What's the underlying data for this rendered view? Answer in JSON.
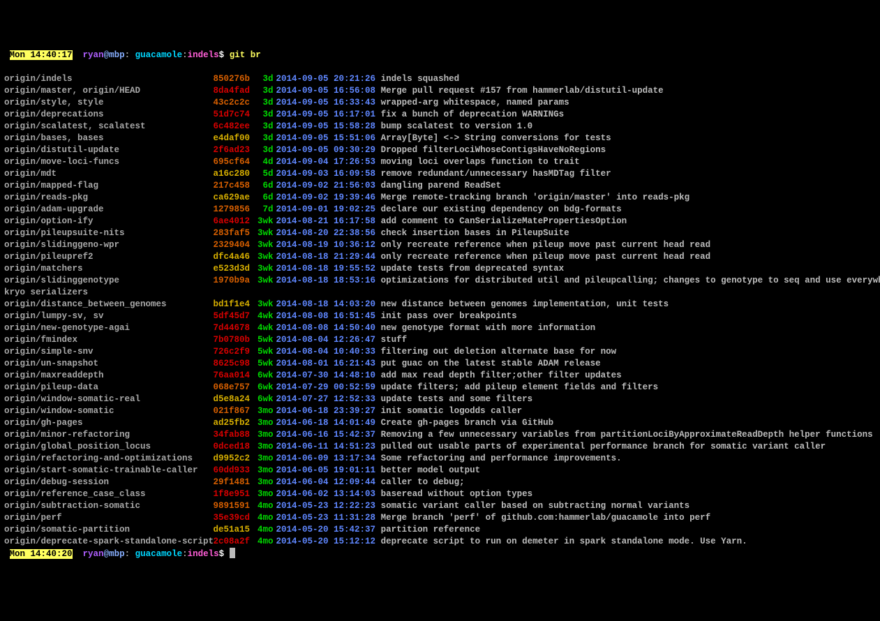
{
  "promptTop": {
    "time": "Mon 14:40:17",
    "user": "ryan",
    "host": "mbp",
    "path": "guacamole",
    "branch": "indels",
    "cmd": "git br"
  },
  "promptBottom": {
    "time": "Mon 14:40:20",
    "user": "ryan",
    "host": "mbp",
    "path": "guacamole",
    "branch": "indels",
    "cmd": ""
  },
  "rows": [
    {
      "branch": "origin/indels",
      "hash": "850276b",
      "hc": "hashOrange",
      "age": "3d",
      "date": "2014-09-05 20:21:26",
      "msg": "indels squashed"
    },
    {
      "branch": "origin/master, origin/HEAD",
      "hash": "8da4fad",
      "hc": "hashRed",
      "age": "3d",
      "date": "2014-09-05 16:56:08",
      "msg": "Merge pull request #157 from hammerlab/distutil-update"
    },
    {
      "branch": "origin/style, style",
      "hash": "43c2c2c",
      "hc": "hashOrange",
      "age": "3d",
      "date": "2014-09-05 16:33:43",
      "msg": "wrapped-arg whitespace, named params"
    },
    {
      "branch": "origin/deprecations",
      "hash": "51d7c74",
      "hc": "hashRed",
      "age": "3d",
      "date": "2014-09-05 16:17:01",
      "msg": "fix a bunch of deprecation WARNINGs"
    },
    {
      "branch": "origin/scalatest, scalatest",
      "hash": "6c482ee",
      "hc": "hashRed",
      "age": "3d",
      "date": "2014-09-05 15:58:28",
      "msg": "bump scalatest to version 1.0"
    },
    {
      "branch": "origin/bases, bases",
      "hash": "e4daf00",
      "hc": "hashYell",
      "age": "3d",
      "date": "2014-09-05 15:51:06",
      "msg": "Array[Byte] <-> String conversions for tests"
    },
    {
      "branch": "origin/distutil-update",
      "hash": "2f6ad23",
      "hc": "hashRed",
      "age": "3d",
      "date": "2014-09-05 09:30:29",
      "msg": "Dropped filterLociWhoseContigsHaveNoRegions"
    },
    {
      "branch": "origin/move-loci-funcs",
      "hash": "695cf64",
      "hc": "hashOrange",
      "age": "4d",
      "date": "2014-09-04 17:26:53",
      "msg": "moving loci overlaps function to trait"
    },
    {
      "branch": "origin/mdt",
      "hash": "a16c280",
      "hc": "hashYell",
      "age": "5d",
      "date": "2014-09-03 16:09:58",
      "msg": "remove redundant/unnecessary hasMDTag filter"
    },
    {
      "branch": "origin/mapped-flag",
      "hash": "217c458",
      "hc": "hashOrange",
      "age": "6d",
      "date": "2014-09-02 21:56:03",
      "msg": "dangling parend ReadSet"
    },
    {
      "branch": "origin/reads-pkg",
      "hash": "ca629ae",
      "hc": "hashYell",
      "age": "6d",
      "date": "2014-09-02 19:39:46",
      "msg": "Merge remote-tracking branch 'origin/master' into reads-pkg"
    },
    {
      "branch": "origin/adam-upgrade",
      "hash": "1279856",
      "hc": "hashOrange",
      "age": "7d",
      "date": "2014-09-01 19:02:25",
      "msg": "declare our existing dependency on bdg-formats"
    },
    {
      "branch": "origin/option-ify",
      "hash": "6ae4012",
      "hc": "hashRed",
      "age": "3wk",
      "date": "2014-08-21 16:17:58",
      "msg": "add comment to CanSerializeMatePropertiesOption"
    },
    {
      "branch": "origin/pileupsuite-nits",
      "hash": "283faf5",
      "hc": "hashOrange",
      "age": "3wk",
      "date": "2014-08-20 22:38:56",
      "msg": "check insertion bases in PileupSuite"
    },
    {
      "branch": "origin/slidinggeno-wpr",
      "hash": "2329404",
      "hc": "hashOrange",
      "age": "3wk",
      "date": "2014-08-19 10:36:12",
      "msg": "only recreate reference when pileup move past current head read"
    },
    {
      "branch": "origin/pileupref2",
      "hash": "dfc4a46",
      "hc": "hashYell",
      "age": "3wk",
      "date": "2014-08-18 21:29:44",
      "msg": "only recreate reference when pileup move past current head read"
    },
    {
      "branch": "origin/matchers",
      "hash": "e523d3d",
      "hc": "hashYell",
      "age": "3wk",
      "date": "2014-08-18 19:55:52",
      "msg": "update tests from deprecated syntax"
    },
    {
      "branch": "origin/slidinggenotype",
      "hash": "1970b9a",
      "hc": "hashOrange",
      "age": "3wk",
      "date": "2014-08-18 18:53:16",
      "msg": "optimizations for distributed util and pileupcalling; changes to genotype to seq and use everywhere; add",
      "wrap": "kryo serializers"
    },
    {
      "branch": "origin/distance_between_genomes",
      "hash": "bd1f1e4",
      "hc": "hashYell",
      "age": "3wk",
      "date": "2014-08-18 14:03:20",
      "msg": "new distance between genomes implementation, unit tests"
    },
    {
      "branch": "origin/lumpy-sv, sv",
      "hash": "5df45d7",
      "hc": "hashRed",
      "age": "4wk",
      "date": "2014-08-08 16:51:45",
      "msg": "init pass over breakpoints"
    },
    {
      "branch": "origin/new-genotype-agai",
      "hash": "7d44678",
      "hc": "hashRed",
      "age": "4wk",
      "date": "2014-08-08 14:50:40",
      "msg": "new genotype format with more information"
    },
    {
      "branch": "origin/fmindex",
      "hash": "7b0780b",
      "hc": "hashRed",
      "age": "5wk",
      "date": "2014-08-04 12:26:47",
      "msg": "stuff"
    },
    {
      "branch": "origin/simple-snv",
      "hash": "726c2f9",
      "hc": "hashRed",
      "age": "5wk",
      "date": "2014-08-04 10:40:33",
      "msg": "filtering out deletion alternate base for now"
    },
    {
      "branch": "origin/un-snapshot",
      "hash": "8625c98",
      "hc": "hashRed",
      "age": "5wk",
      "date": "2014-08-01 16:21:43",
      "msg": "put guac on the latest stable ADAM release"
    },
    {
      "branch": "origin/maxreaddepth",
      "hash": "76aa014",
      "hc": "hashRed",
      "age": "6wk",
      "date": "2014-07-30 14:48:10",
      "msg": "add max read depth filter;other filter updates"
    },
    {
      "branch": "origin/pileup-data",
      "hash": "068e757",
      "hc": "hashOrange",
      "age": "6wk",
      "date": "2014-07-29 00:52:59",
      "msg": "update filters; add pileup element fields and filters"
    },
    {
      "branch": "origin/window-somatic-real",
      "hash": "d5e8a24",
      "hc": "hashYell",
      "age": "6wk",
      "date": "2014-07-27 12:52:33",
      "msg": "update tests and some filters"
    },
    {
      "branch": "origin/window-somatic",
      "hash": "021f867",
      "hc": "hashOrange",
      "age": "3mo",
      "date": "2014-06-18 23:39:27",
      "msg": "init somatic logodds caller"
    },
    {
      "branch": "origin/gh-pages",
      "hash": "ad25fb2",
      "hc": "hashYell",
      "age": "3mo",
      "date": "2014-06-18 14:01:49",
      "msg": "Create gh-pages branch via GitHub"
    },
    {
      "branch": "origin/minor-refactoring",
      "hash": "34fab88",
      "hc": "hashRed",
      "age": "3mo",
      "date": "2014-06-16 15:42:37",
      "msg": "Removing a few unnecessary variables from partitionLociByApproximateReadDepth helper functions"
    },
    {
      "branch": "origin/global_position_locus",
      "hash": "0dced18",
      "hc": "hashRed",
      "age": "3mo",
      "date": "2014-06-11 14:51:23",
      "msg": "pulled out usable parts of experimental performance branch for somatic variant caller"
    },
    {
      "branch": "origin/refactoring-and-optimizations",
      "hash": "d9952c2",
      "hc": "hashYell",
      "age": "3mo",
      "date": "2014-06-09 13:17:34",
      "msg": "Some refactoring and performance improvements."
    },
    {
      "branch": "origin/start-somatic-trainable-caller",
      "hash": "60dd933",
      "hc": "hashRed",
      "age": "3mo",
      "date": "2014-06-05 19:01:11",
      "msg": "better model output"
    },
    {
      "branch": "origin/debug-session",
      "hash": "29f1481",
      "hc": "hashOrange",
      "age": "3mo",
      "date": "2014-06-04 12:09:44",
      "msg": "caller to debug;"
    },
    {
      "branch": "origin/reference_case_class",
      "hash": "1f8e951",
      "hc": "hashRed",
      "age": "3mo",
      "date": "2014-06-02 13:14:03",
      "msg": "baseread without option types"
    },
    {
      "branch": "origin/subtraction-somatic",
      "hash": "9891591",
      "hc": "hashOrange",
      "age": "4mo",
      "date": "2014-05-23 12:22:23",
      "msg": "somatic variant caller based on subtracting normal variants"
    },
    {
      "branch": "origin/perf",
      "hash": "35e39cd",
      "hc": "hashRed",
      "age": "4mo",
      "date": "2014-05-23 11:31:28",
      "msg": "Merge branch 'perf' of github.com:hammerlab/guacamole into perf"
    },
    {
      "branch": "origin/somatic-partition",
      "hash": "de51a15",
      "hc": "hashYell",
      "age": "4mo",
      "date": "2014-05-20 15:42:37",
      "msg": "partition reference"
    },
    {
      "branch": "origin/deprecate-spark-standalone-script",
      "hash": "2c08a2f",
      "hc": "hashRed",
      "age": "4mo",
      "date": "2014-05-20 15:12:12",
      "msg": "deprecate script to run on demeter in spark standalone mode. Use Yarn."
    }
  ]
}
